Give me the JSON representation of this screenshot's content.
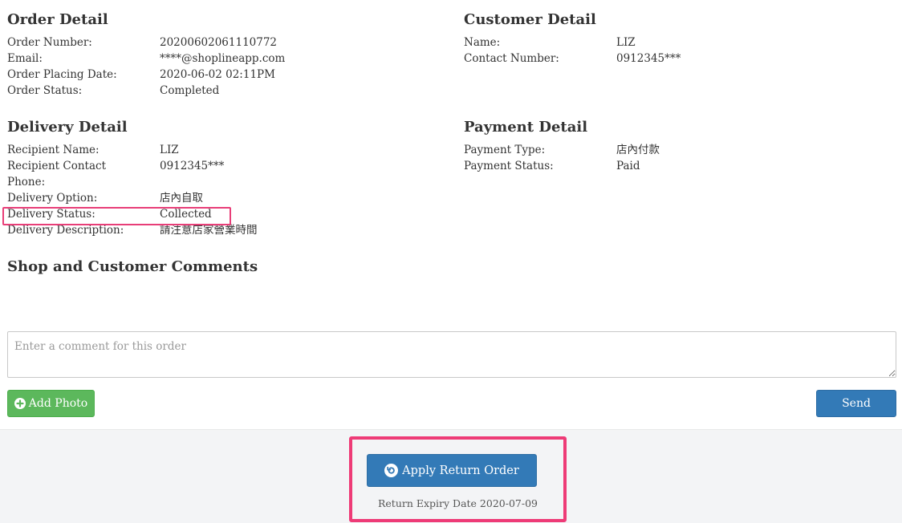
{
  "order_detail": {
    "title": "Order Detail",
    "rows": [
      {
        "label": "Order Number:",
        "value": "20200602061110772"
      },
      {
        "label": "Email:",
        "value": "****@shoplineapp.com"
      },
      {
        "label": "Order Placing Date:",
        "value": "2020-06-02 02:11PM"
      },
      {
        "label": "Order Status:",
        "value": "Completed"
      }
    ]
  },
  "customer_detail": {
    "title": "Customer Detail",
    "rows": [
      {
        "label": "Name:",
        "value": "LIZ"
      },
      {
        "label": "Contact Number:",
        "value": "0912345***"
      }
    ]
  },
  "delivery_detail": {
    "title": "Delivery Detail",
    "rows": [
      {
        "label": "Recipient Name:",
        "value": "LIZ"
      },
      {
        "label": "Recipient Contact Phone:",
        "value": "0912345***"
      },
      {
        "label": "Delivery Option:",
        "value": "店內自取"
      },
      {
        "label": "Delivery Status:",
        "value": "Collected"
      },
      {
        "label": "Delivery Description:",
        "value": "請注意店家營業時間"
      }
    ]
  },
  "payment_detail": {
    "title": "Payment Detail",
    "rows": [
      {
        "label": "Payment Type:",
        "value": "店內付款"
      },
      {
        "label": "Payment Status:",
        "value": "Paid"
      }
    ]
  },
  "comments": {
    "title": "Shop and Customer Comments",
    "placeholder": "Enter a comment for this order",
    "add_photo_label": "Add Photo",
    "send_label": "Send"
  },
  "return": {
    "button_label": "Apply Return Order",
    "expiry_text": "Return Expiry Date 2020-07-09"
  },
  "colors": {
    "primary": "#337ab7",
    "success": "#5cb85c",
    "highlight": "#ee3b77"
  },
  "icons": {
    "add_photo": "plus-circle-icon",
    "return": "undo-circle-icon"
  }
}
